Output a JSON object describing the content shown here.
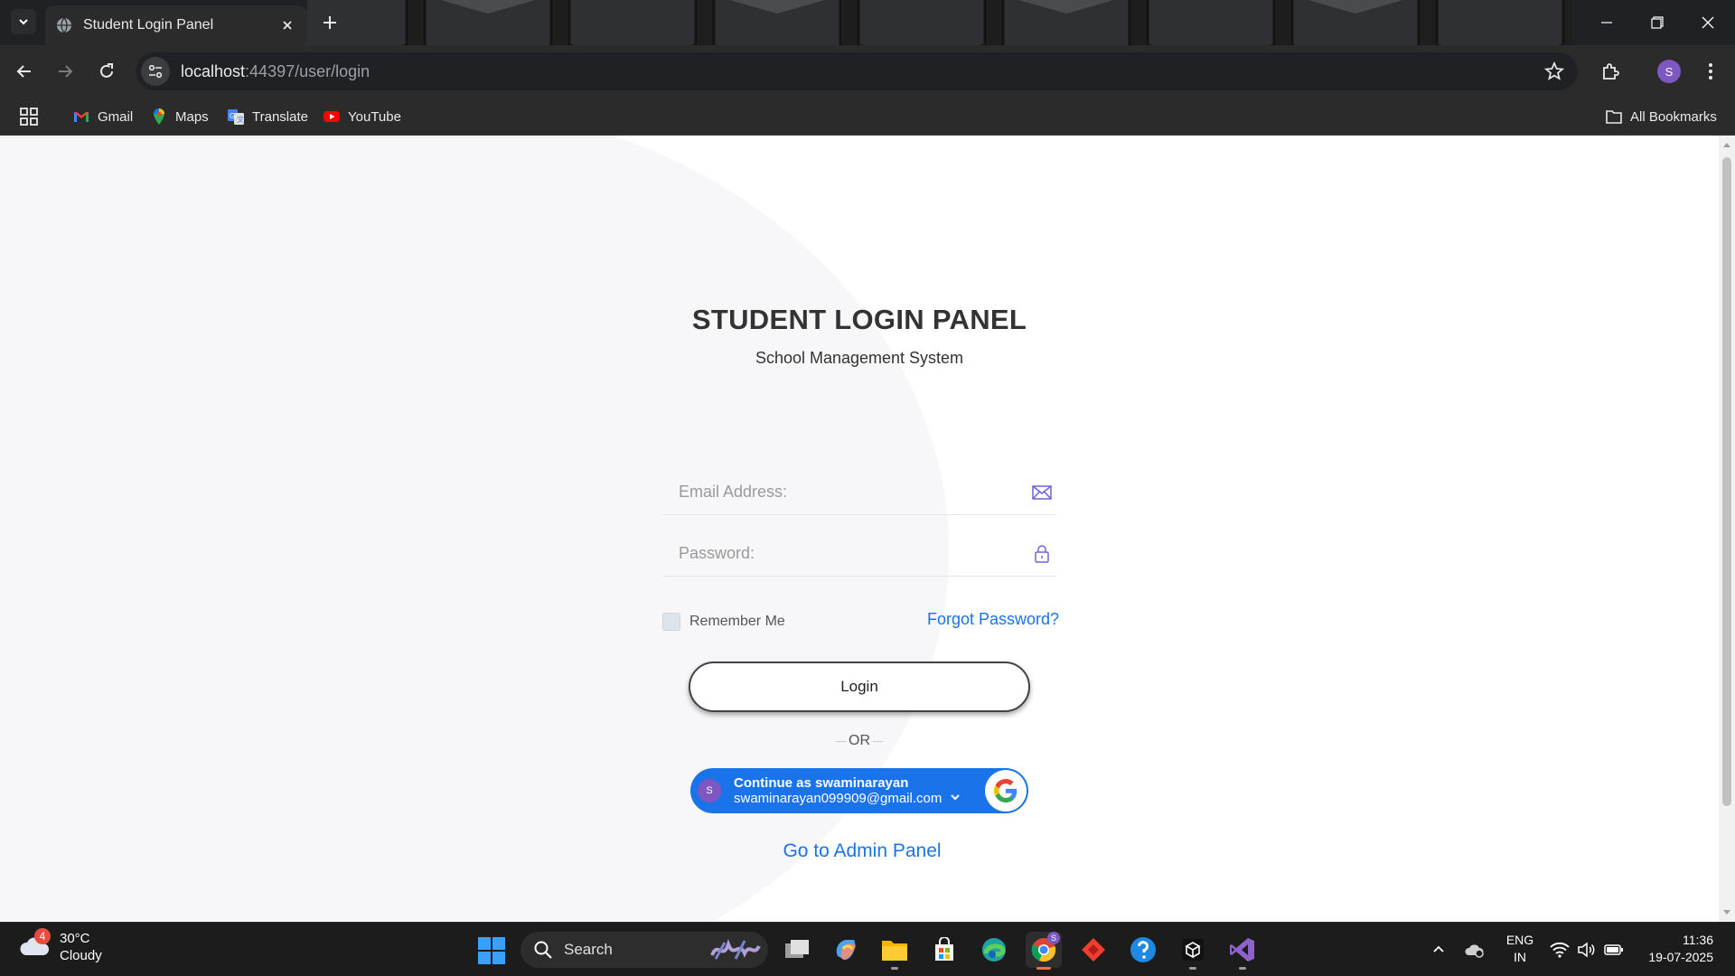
{
  "browser": {
    "tab_title": "Student Login Panel",
    "url_host": "localhost",
    "url_rest": ":44397/user/login",
    "profile_initial": "S",
    "bookmarks": [
      {
        "label": "Gmail",
        "icon": "gmail-icon"
      },
      {
        "label": "Maps",
        "icon": "maps-icon"
      },
      {
        "label": "Translate",
        "icon": "translate-icon"
      },
      {
        "label": "YouTube",
        "icon": "youtube-icon"
      }
    ],
    "all_bookmarks": "All Bookmarks"
  },
  "login": {
    "title": "STUDENT LOGIN PANEL",
    "subtitle": "School Management System",
    "email_placeholder": "Email Address:",
    "password_placeholder": "Password:",
    "remember_label": "Remember Me",
    "forgot_label": "Forgot Password?",
    "login_button": "Login",
    "or_text": "OR",
    "google": {
      "avatar_initial": "S",
      "name_line": "Continue as swaminarayan",
      "email": "swaminarayan099909@gmail.com"
    },
    "admin_link": "Go to Admin Panel"
  },
  "taskbar": {
    "weather_badge": "4",
    "temperature": "30°C",
    "condition": "Cloudy",
    "search_label": "Search",
    "chrome_badge": "S",
    "lang_top": "ENG",
    "lang_bottom": "IN",
    "time": "11:36",
    "date": "19-07-2025"
  },
  "colors": {
    "accent_blue": "#1a73e8",
    "profile_purple": "#7e57c2",
    "browser_dark": "#2b2b2b"
  }
}
